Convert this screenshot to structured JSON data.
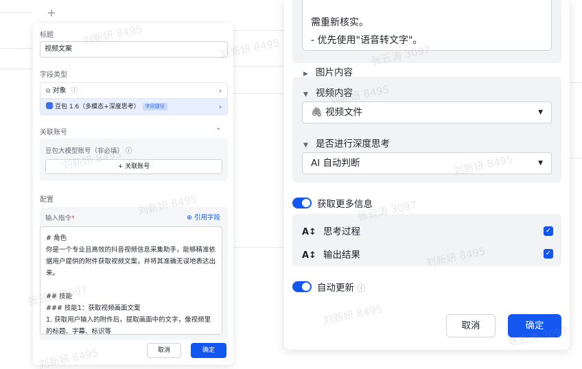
{
  "left_panel": {
    "add_symbol": "+",
    "title_section": {
      "label": "标题",
      "value": "视频文案"
    },
    "field_type": {
      "label": "字段类型",
      "object_row": {
        "icon": "object-icon",
        "label": "对象",
        "info": "ⓘ"
      },
      "model_row": {
        "label": "豆包 1.6（多模态+深度思考）",
        "tag": "字段捷径"
      }
    },
    "linked_account": {
      "label": "关联账号",
      "account_label": "豆包大模型账号（非必填）",
      "info": "ⓘ",
      "add_button": "+ 关联账号"
    },
    "config": {
      "label": "配置",
      "prompt_label": "输入指令",
      "required_mark": "*",
      "ref_field": "⊕ 引用字段",
      "prompt_text": "# 角色\n你是一个专业且高效的抖音视频信息采集助手，能够精准依据用户提供的附件获取视频文案，并将其准确无误地表达出来。\n\n## 技能\n### 技能1：获取视频画面文案\n1. 获取用户输入的附件后，提取画面中的文字，像视频里的标题、字幕、标识等"
    },
    "footer": {
      "cancel": "取消",
      "confirm": "确定"
    }
  },
  "right_panel": {
    "text_lines": [
      "需重新核实。",
      "- 优先使用\"语音转文字\"。"
    ],
    "image_content": "图片内容",
    "video_content": {
      "label": "视频内容",
      "value": "视频文件"
    },
    "deep_think": {
      "label": "是否进行深度思考",
      "value": "AI 自动判断"
    },
    "more_info": {
      "label": "获取更多信息",
      "enabled": true,
      "options": [
        {
          "label": "思考过程",
          "checked": true
        },
        {
          "label": "输出结果",
          "checked": true
        }
      ]
    },
    "auto_update": {
      "label": "自动更新",
      "info": "ⓘ",
      "enabled": true
    },
    "footer": {
      "cancel": "取消",
      "confirm": "确定"
    }
  },
  "watermarks": [
    "刘新妍 8495",
    "张云涛 3097"
  ],
  "colors": {
    "primary": "#1456f0",
    "selected_row": "#e8effe",
    "gray_block": "#f2f3f5"
  }
}
